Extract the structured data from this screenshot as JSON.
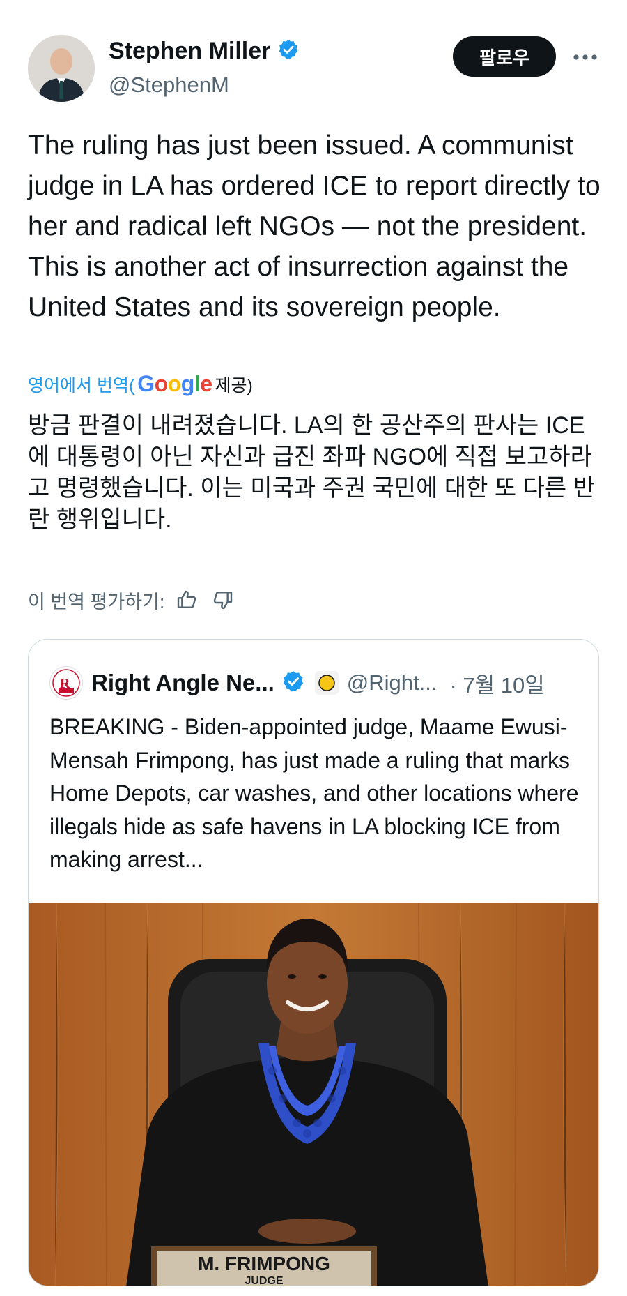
{
  "tweet": {
    "author": {
      "name": "Stephen Miller",
      "handle": "@StephenM"
    },
    "follow_label": "팔로우",
    "text": "The ruling has just been issued. A communist judge in LA has ordered ICE to report directly to her and radical left NGOs — not the president. This is another act of insurrection against the United States and its sovereign people.",
    "translate": {
      "link_label": "영어에서 번역(",
      "provider": "Google",
      "provided_label": "제공)"
    },
    "translated_text": "방금 판결이 내려졌습니다. LA의 한 공산주의 판사는 ICE에 대통령이 아닌 자신과 급진 좌파 NGO에 직접 보고하라고 명령했습니다. 이는 미국과 주권 국민에 대한 또 다른 반란 행위입니다.",
    "rate_label": "이 번역 평가하기:"
  },
  "quote": {
    "author": {
      "name": "Right Angle Ne...",
      "handle": "@Right...",
      "date": "· 7월 10일"
    },
    "text": "BREAKING - Biden-appointed judge, Maame Ewusi-Mensah Frimpong, has just made a ruling that marks Home Depots, car washes, and other locations where illegals hide as safe havens in LA blocking ICE from making arrest...",
    "media": {
      "nameplate_name": "M. FRIMPONG",
      "nameplate_title": "JUDGE"
    }
  },
  "colors": {
    "verified": "#1d9bf0",
    "text_primary": "#0f1419",
    "text_secondary": "#536471",
    "link": "#1d9bf0",
    "border": "#cfd9de",
    "wood": "#b36a2a"
  },
  "icons": [
    "verified-badge-icon",
    "more-options-icon",
    "thumbs-up-icon",
    "thumbs-down-icon",
    "emoji-badge-icon"
  ]
}
